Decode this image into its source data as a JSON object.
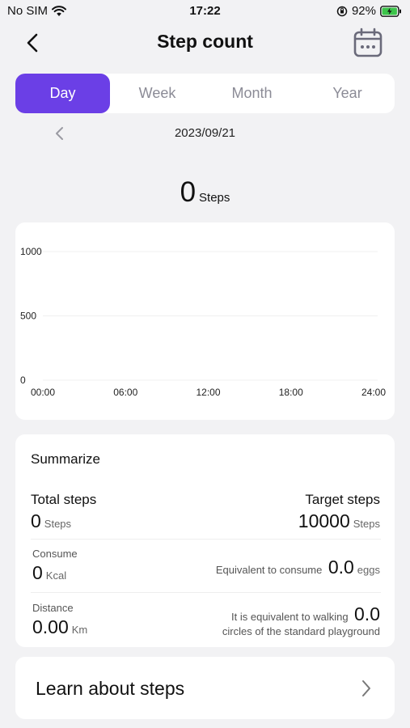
{
  "status_bar": {
    "carrier": "No SIM",
    "time": "17:22",
    "battery": "92%"
  },
  "header": {
    "title": "Step count"
  },
  "tabs": [
    {
      "label": "Day",
      "active": true
    },
    {
      "label": "Week",
      "active": false
    },
    {
      "label": "Month",
      "active": false
    },
    {
      "label": "Year",
      "active": false
    }
  ],
  "date": "2023/09/21",
  "steps": {
    "value": "0",
    "unit": "Steps"
  },
  "chart_data": {
    "type": "bar",
    "x_ticks": [
      "00:00",
      "06:00",
      "12:00",
      "18:00",
      "24:00"
    ],
    "y_ticks": [
      "1000",
      "500",
      "0"
    ],
    "ylim": [
      0,
      1000
    ],
    "values": [],
    "grid": true
  },
  "summary": {
    "title": "Summarize",
    "total_steps": {
      "label": "Total steps",
      "value": "0",
      "unit": "Steps"
    },
    "target_steps": {
      "label": "Target steps",
      "value": "10000",
      "unit": "Steps"
    },
    "consume": {
      "label": "Consume",
      "value": "0",
      "unit": "Kcal"
    },
    "eggs": {
      "prefix": "Equivalent to consume",
      "value": "0.0",
      "unit": "eggs"
    },
    "distance": {
      "label": "Distance",
      "value": "0.00",
      "unit": "Km"
    },
    "playground": {
      "prefix": "It is equivalent to walking",
      "value": "0.0",
      "suffix": "circles of the standard playground"
    }
  },
  "learn": {
    "label": "Learn about steps"
  },
  "colors": {
    "accent": "#6b3fe6",
    "background": "#f2f2f4",
    "battery": "#3cc44a"
  }
}
